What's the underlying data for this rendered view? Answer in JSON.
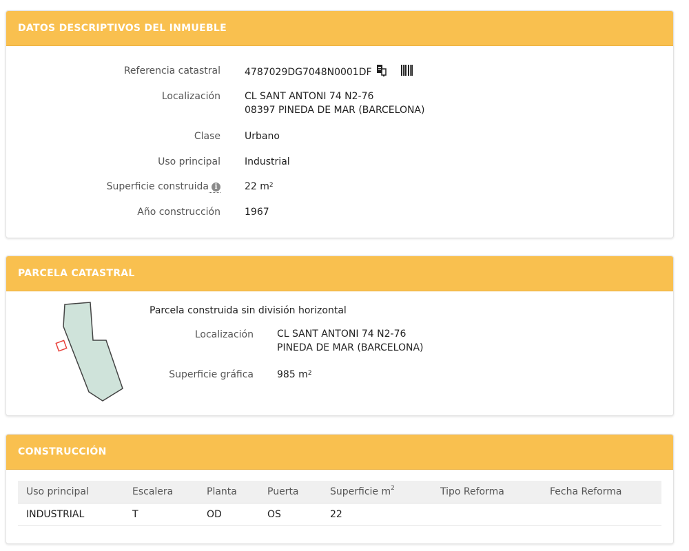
{
  "panel1": {
    "header": "DATOS DESCRIPTIVOS DEL INMUEBLE",
    "ref_label": "Referencia catastral",
    "ref_value": "4787029DG7048N0001DF",
    "loc_label": "Localización",
    "loc_line1": "CL SANT ANTONI 74 N2-76",
    "loc_line2": "08397 PINEDA DE MAR (BARCELONA)",
    "clase_label": "Clase",
    "clase_value": "Urbano",
    "uso_label": "Uso principal",
    "uso_value": "Industrial",
    "sup_label": "Superficie construida",
    "sup_value": "22 m",
    "sup_unit_exp": "2",
    "info_glyph": "i",
    "anio_label": "Año construcción",
    "anio_value": "1967"
  },
  "panel2": {
    "header": "PARCELA CATASTRAL",
    "title": "Parcela construida sin división horizontal",
    "loc_label": "Localización",
    "loc_line1": "CL SANT ANTONI 74 N2-76",
    "loc_line2": "PINEDA DE MAR (BARCELONA)",
    "sup_label": "Superficie gráfica",
    "sup_value": "985 m",
    "sup_unit_exp": "2"
  },
  "panel3": {
    "header": "CONSTRUCCIÓN",
    "columns": [
      "Uso principal",
      "Escalera",
      "Planta",
      "Puerta",
      "Superficie m",
      "Tipo Reforma",
      "Fecha Reforma"
    ],
    "sup_col_exp": "2",
    "rows": [
      [
        "INDUSTRIAL",
        "T",
        "OD",
        "OS",
        "22",
        "",
        ""
      ]
    ]
  },
  "colors": {
    "header_bg": "#f9c04f",
    "header_text": "#ffffff",
    "parcel_fill": "#cfe3da",
    "highlight_stroke": "#e8403a"
  },
  "icons": [
    "copy-icon",
    "barcode-icon",
    "info-icon"
  ]
}
